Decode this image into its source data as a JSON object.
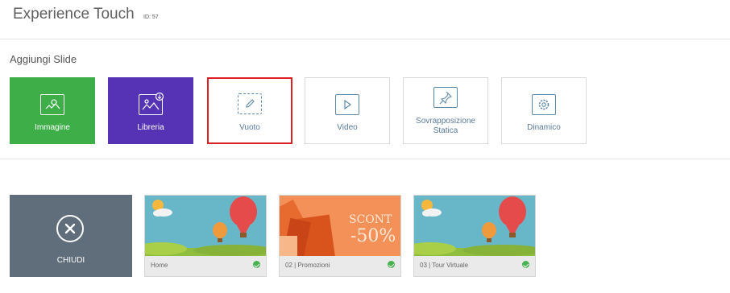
{
  "header": {
    "title": "Experience Touch",
    "id_label": "ID: 57"
  },
  "add_slide": {
    "label": "Aggiungi Slide",
    "options": [
      {
        "label": "Immagine",
        "icon": "image-sun-icon",
        "color": "#3eae49"
      },
      {
        "label": "Libreria",
        "icon": "library-image-icon",
        "color": "#5533b4"
      },
      {
        "label": "Vuoto",
        "icon": "empty-pencil-icon",
        "selected": true
      },
      {
        "label": "Video",
        "icon": "play-icon"
      },
      {
        "label": "Sovrapposizione Statica",
        "icon": "pin-icon"
      },
      {
        "label": "Dinamico",
        "icon": "gear-icon"
      }
    ]
  },
  "slides": {
    "close_label": "CHIUDI",
    "items": [
      {
        "caption": "Home",
        "status": "check-icon"
      },
      {
        "caption": "02 | Promozioni",
        "status": "check-icon",
        "thumb_text": [
          "SCONT",
          "-50%"
        ]
      },
      {
        "caption": "03 | Tour Virtuale",
        "status": "check-icon"
      }
    ]
  },
  "colors": {
    "accent_selected": "#e02020",
    "close_bg": "#5f6e7a",
    "status_ok": "#46b34f"
  }
}
